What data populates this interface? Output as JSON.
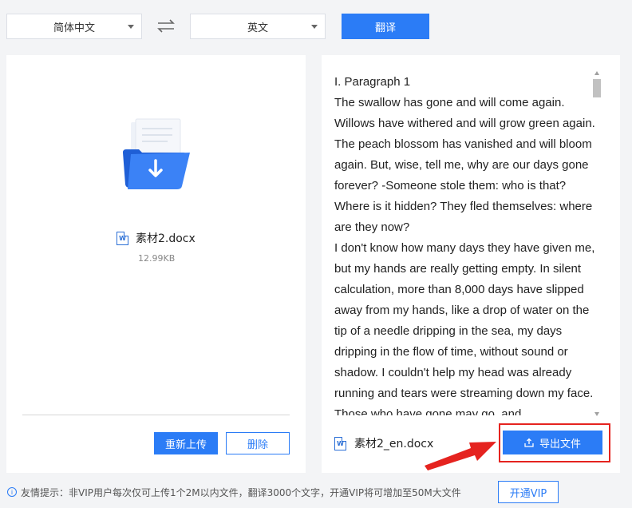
{
  "toolbar": {
    "source_language": "简体中文",
    "target_language": "英文",
    "translate_label": "翻译"
  },
  "left_panel": {
    "file_name": "素材2.docx",
    "file_size": "12.99KB",
    "file_icon_letter": "W",
    "reupload_label": "重新上传",
    "delete_label": "删除"
  },
  "right_panel": {
    "paragraphs": [
      "I. Paragraph 1",
      "The swallow has gone and will come again. Willows have withered and will grow green again. The peach blossom has vanished and will bloom again. But, wise, tell me, why are our days gone forever? -Someone stole them: who is that? Where is it hidden? They fled themselves: where are they now?",
      "I don't know how many days they have given me, but my hands are really getting empty. In silent calculation, more than 8,000 days have slipped away from my hands, like a drop of water on the tip of a needle dripping in the sea, my days dripping in the flow of time, without sound or shadow. I couldn't help my head was already running and tears were streaming down my face. Those who have gone may go, and"
    ],
    "output_file_name": "素材2_en.docx",
    "export_label": "导出文件"
  },
  "footer": {
    "tip": "友情提示：非VIP用户每次仅可上传1个2M以内文件，翻译3000个文字，开通VIP将可增加至50M大文件",
    "vip_label": "开通VIP"
  },
  "colors": {
    "accent": "#2b7cf6",
    "highlight_red": "#e5231f",
    "background": "#f3f4f6"
  }
}
